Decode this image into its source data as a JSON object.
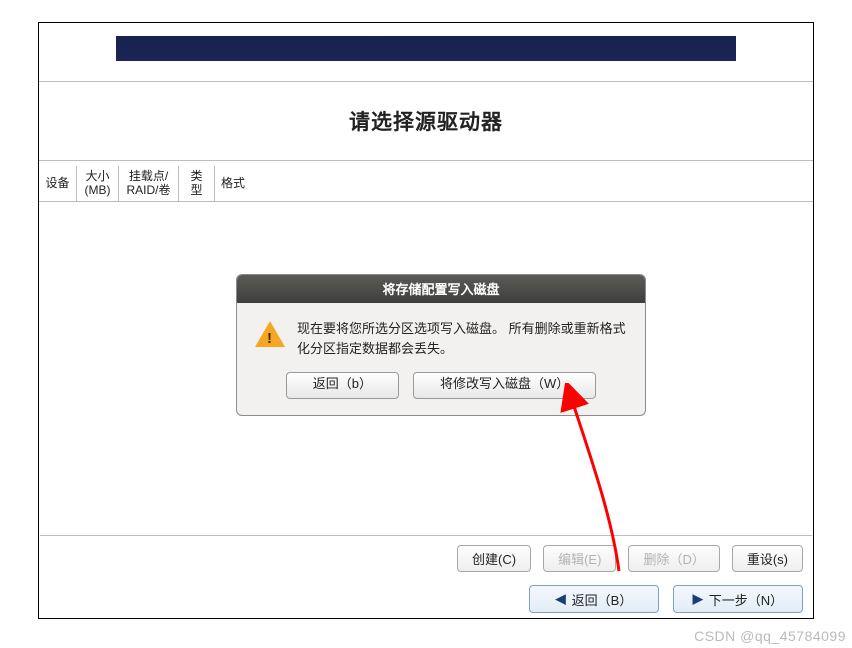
{
  "page": {
    "title": "请选择源驱动器"
  },
  "table": {
    "columns": [
      "设备",
      "大小\n(MB)",
      "挂载点/\nRAID/卷",
      "类型",
      "格式"
    ]
  },
  "dialog": {
    "title": "将存储配置写入磁盘",
    "message": "现在要将您所选分区选项写入磁盘。 所有删除或重新格式化分区指定数据都会丢失。",
    "back": "返回（b）",
    "write": "将修改写入磁盘（W）"
  },
  "buttons": {
    "create": "创建(C)",
    "edit": "编辑(E)",
    "delete": "删除（D）",
    "reset": "重设(s)"
  },
  "nav": {
    "back": "返回（B）",
    "next": "下一步（N）"
  },
  "watermark": "CSDN @qq_45784099"
}
